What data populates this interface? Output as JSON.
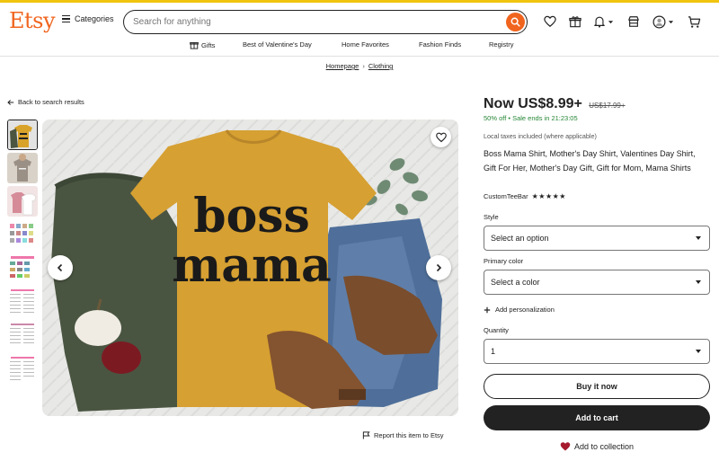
{
  "header": {
    "logo": "Etsy",
    "categories_label": "Categories",
    "search_placeholder": "Search for anything"
  },
  "nav": {
    "items": [
      "Gifts",
      "Best of Valentine's Day",
      "Home Favorites",
      "Fashion Finds",
      "Registry"
    ]
  },
  "breadcrumb": {
    "items": [
      "Homepage",
      "Clothing"
    ]
  },
  "back_link": "Back to search results",
  "listing": {
    "price_now": "Now US$8.99+",
    "price_old": "US$17.99+",
    "sale_text": "50% off • Sale ends in 21:23:05",
    "taxes": "Local taxes included (where applicable)",
    "title": "Boss Mama Shirt, Mother's Day Shirt, Valentines Day Shirt, Gift For Her, Mother's Day Gift, Gift for Mom, Mama Shirts",
    "shop_name": "CustomTeeBar",
    "rating_stars": "★★★★★",
    "rating_value": 4.5,
    "style_label": "Style",
    "style_value": "Select an option",
    "color_label": "Primary color",
    "color_value": "Select a color",
    "personalization": "Add personalization",
    "quantity_label": "Quantity",
    "quantity_value": "1",
    "buy_now": "Buy it now",
    "add_to_cart": "Add to cart",
    "add_to_collection": "Add to collection"
  },
  "image": {
    "shirt_text_line1": "boss",
    "shirt_text_line2": "mama",
    "report": "Report this item to Etsy"
  },
  "colors": {
    "brand": "#f1641e",
    "sale_green": "#258635",
    "heart_red": "#a61a2e"
  }
}
